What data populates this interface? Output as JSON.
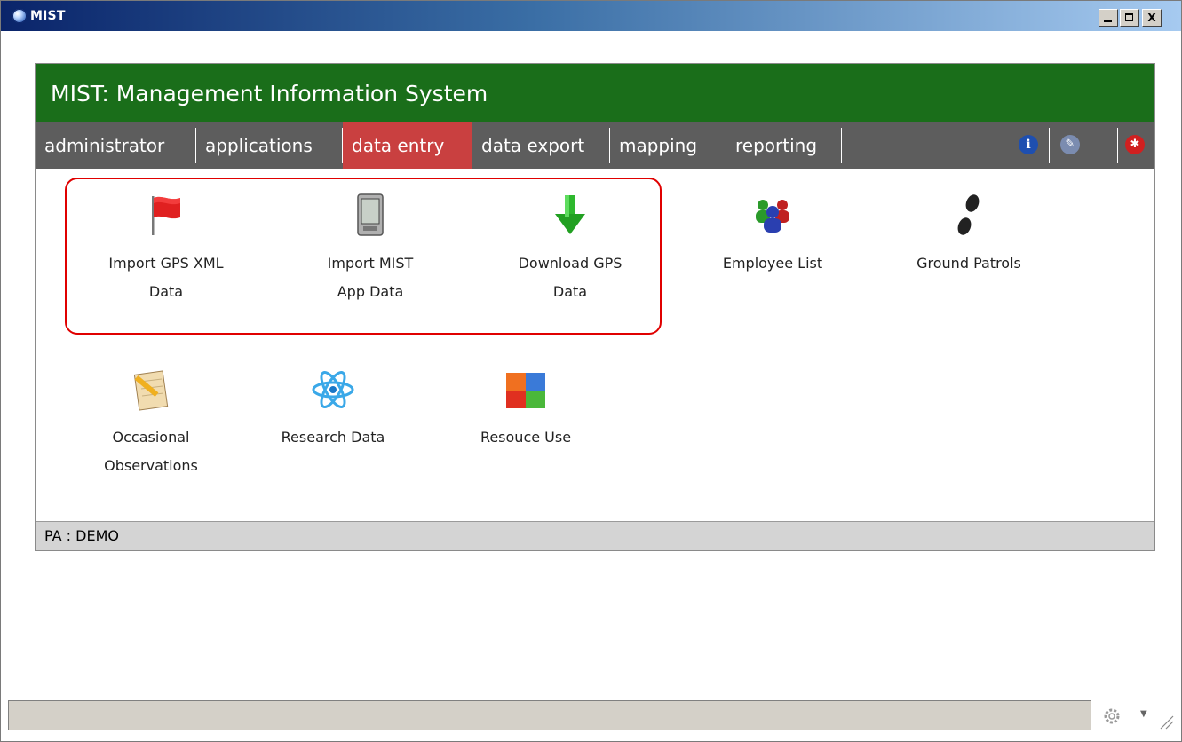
{
  "window": {
    "title": "MIST",
    "min_label": "_",
    "max_label": "□",
    "close_label": "X"
  },
  "header": {
    "title": "MIST: Management Information System"
  },
  "nav": {
    "tabs": [
      {
        "label": "administrator"
      },
      {
        "label": "applications"
      },
      {
        "label": "data entry",
        "active": true
      },
      {
        "label": "data export"
      },
      {
        "label": "mapping"
      },
      {
        "label": "reporting"
      }
    ],
    "icons": [
      {
        "name": "info-icon",
        "glyph": "i",
        "color": "#1e4fb0"
      },
      {
        "name": "pen-icon",
        "glyph": "✎",
        "color": "#6a7fa0"
      },
      {
        "name": "lifebuoy-icon",
        "glyph": "✱",
        "color": "#d02020"
      }
    ]
  },
  "items": [
    {
      "label_line1": "Import GPS XML",
      "label_line2": "Data",
      "icon": "red-flag-icon"
    },
    {
      "label_line1": "Import MIST",
      "label_line2": "App Data",
      "icon": "pda-device-icon"
    },
    {
      "label_line1": "Download GPS",
      "label_line2": "Data",
      "icon": "green-down-arrow-icon"
    },
    {
      "label_line1": "Employee List",
      "label_line2": "",
      "icon": "people-group-icon"
    },
    {
      "label_line1": "Ground Patrols",
      "label_line2": "",
      "icon": "footprints-icon"
    },
    {
      "label_line1": "Occasional",
      "label_line2": "Observations",
      "icon": "notepad-pencil-icon"
    },
    {
      "label_line1": "Research Data",
      "label_line2": "",
      "icon": "atom-icon"
    },
    {
      "label_line1": "Resouce Use",
      "label_line2": "",
      "icon": "color-blocks-icon"
    }
  ],
  "status": {
    "pa_text": "PA : DEMO"
  },
  "colors": {
    "header_green": "#1a6e1a",
    "nav_gray": "#5d5d5d",
    "active_tab_red": "#c94040",
    "highlight_red": "#e00000"
  }
}
